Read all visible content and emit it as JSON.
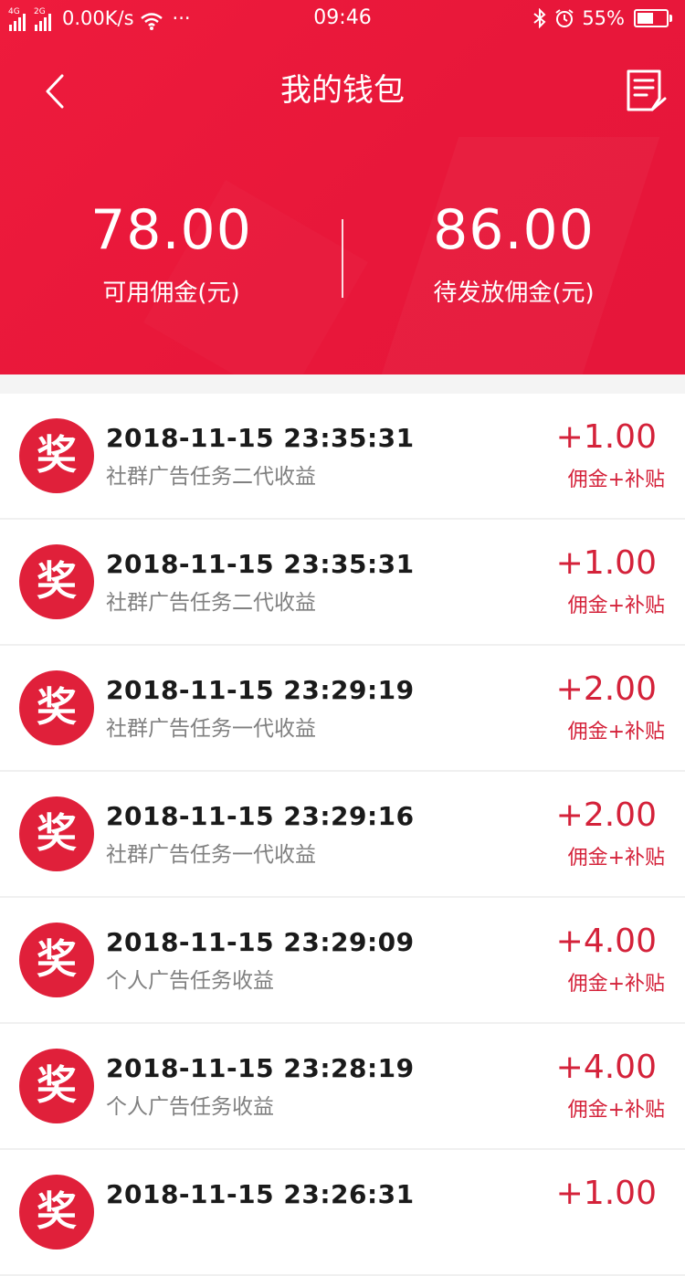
{
  "status_bar": {
    "net_tag_1": "4G",
    "net_tag_2": "2G",
    "speed": "0.00K/s",
    "more": "···",
    "time": "09:46",
    "battery": "55%",
    "battery_level": 0.55
  },
  "nav": {
    "title": "我的钱包",
    "back_icon": "chevron-left-icon",
    "bill_icon": "bill-icon"
  },
  "summary": {
    "available_amount": "78.00",
    "available_label": "可用佣金(元)",
    "pending_amount": "86.00",
    "pending_label": "待发放佣金(元)"
  },
  "colors": {
    "header_bg": "#e8173a",
    "accent": "#d4223a",
    "badge": "#e0203a"
  },
  "records": [
    {
      "badge": "奖",
      "time": "2018-11-15 23:35:31",
      "desc": "社群广告任务二代收益",
      "amount": "+1.00",
      "type": "佣金+补贴"
    },
    {
      "badge": "奖",
      "time": "2018-11-15 23:35:31",
      "desc": "社群广告任务二代收益",
      "amount": "+1.00",
      "type": "佣金+补贴"
    },
    {
      "badge": "奖",
      "time": "2018-11-15 23:29:19",
      "desc": "社群广告任务一代收益",
      "amount": "+2.00",
      "type": "佣金+补贴"
    },
    {
      "badge": "奖",
      "time": "2018-11-15 23:29:16",
      "desc": "社群广告任务一代收益",
      "amount": "+2.00",
      "type": "佣金+补贴"
    },
    {
      "badge": "奖",
      "time": "2018-11-15 23:29:09",
      "desc": "个人广告任务收益",
      "amount": "+4.00",
      "type": "佣金+补贴"
    },
    {
      "badge": "奖",
      "time": "2018-11-15 23:28:19",
      "desc": "个人广告任务收益",
      "amount": "+4.00",
      "type": "佣金+补贴"
    },
    {
      "badge": "奖",
      "time": "2018-11-15 23:26:31",
      "desc": "",
      "amount": "+1.00",
      "type": ""
    }
  ]
}
